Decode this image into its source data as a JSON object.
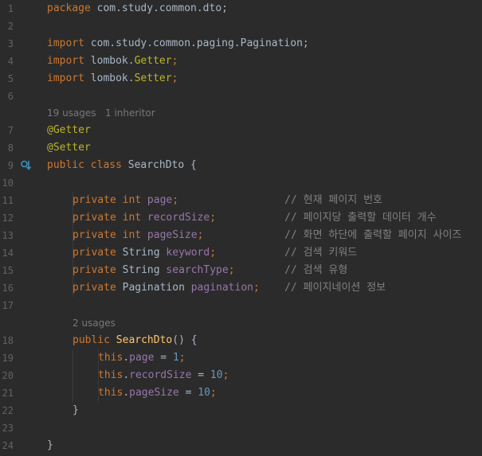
{
  "line_numbers": [
    "1",
    "2",
    "3",
    "4",
    "5",
    "6",
    "7",
    "8",
    "9",
    "10",
    "11",
    "12",
    "13",
    "14",
    "15",
    "16",
    "17",
    "18",
    "19",
    "20",
    "21",
    "22",
    "23",
    "24"
  ],
  "hints": {
    "class_usages": "19 usages",
    "class_inheritors": "1 inheritor",
    "ctor_usages": "2 usages"
  },
  "code": {
    "l1": {
      "kw": "package",
      "rest": " com.study.common.dto;"
    },
    "l3": {
      "kw": "import",
      "rest": " com.study.common.paging.Pagination;"
    },
    "l4": {
      "kw": "import",
      "pkg": " lombok.",
      "ann": "Getter",
      "semi": ";"
    },
    "l5": {
      "kw": "import",
      "pkg": " lombok.",
      "ann": "Setter",
      "semi": ";"
    },
    "l7": {
      "ann": "@Getter"
    },
    "l8": {
      "ann": "@Setter"
    },
    "l9": {
      "kw": "public class",
      "rest": " SearchDto {"
    },
    "fields": [
      {
        "mod": "private",
        "type_kw": " int",
        "type": "",
        "name": " page",
        "semi": ";",
        "pad": "                 ",
        "comment": "// 현재 페이지 번호"
      },
      {
        "mod": "private",
        "type_kw": " int",
        "type": "",
        "name": " recordSize",
        "semi": ";",
        "pad": "           ",
        "comment": "// 페이지당 출력할 데이터 개수"
      },
      {
        "mod": "private",
        "type_kw": " int",
        "type": "",
        "name": " pageSize",
        "semi": ";",
        "pad": "             ",
        "comment": "// 화면 하단에 출력할 페이지 사이즈"
      },
      {
        "mod": "private",
        "type_kw": "",
        "type": " String",
        "name": " keyword",
        "semi": ";",
        "pad": "           ",
        "comment": "// 검색 키워드"
      },
      {
        "mod": "private",
        "type_kw": "",
        "type": " String",
        "name": " searchType",
        "semi": ";",
        "pad": "        ",
        "comment": "// 검색 유형"
      },
      {
        "mod": "private",
        "type_kw": "",
        "type": " Pagination",
        "name": " pagination",
        "semi": ";",
        "pad": "    ",
        "comment": "// 페이지네이션 정보"
      }
    ],
    "l18": {
      "kw": "public",
      "fn": " SearchDto",
      "rest": "() {"
    },
    "assigns": [
      {
        "kw": "this",
        "dot": ".",
        "field": "page",
        "op": " = ",
        "num": "1",
        "semi": ";"
      },
      {
        "kw": "this",
        "dot": ".",
        "field": "recordSize",
        "op": " = ",
        "num": "10",
        "semi": ";"
      },
      {
        "kw": "this",
        "dot": ".",
        "field": "pageSize",
        "op": " = ",
        "num": "10",
        "semi": ";"
      }
    ],
    "l22": {
      "brace": "}"
    },
    "l24": {
      "brace": "}"
    }
  },
  "icons": {
    "gutter_line9": "implemented-class-icon"
  },
  "colors": {
    "background": "#2b2b2b",
    "keyword": "#cc7832",
    "annotation": "#bbb529",
    "field": "#9876aa",
    "number": "#6897bb",
    "comment": "#808080",
    "method": "#ffc66d",
    "text": "#a9b7c6",
    "line_number": "#606366"
  }
}
